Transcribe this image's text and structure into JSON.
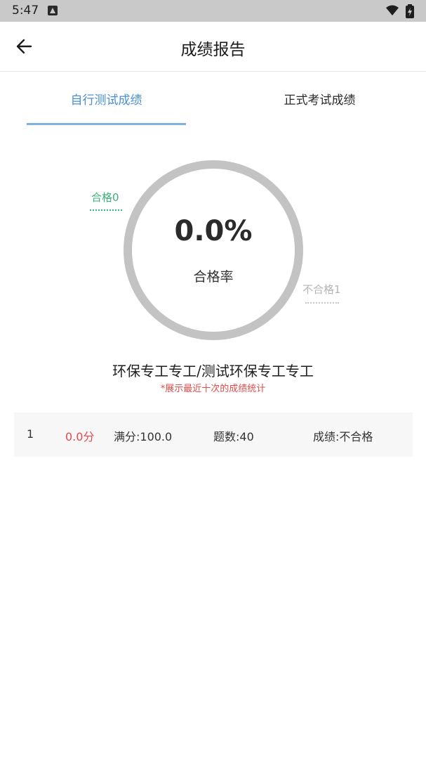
{
  "status_bar": {
    "time": "5:47",
    "icons": [
      "notification-icon",
      "wifi-icon",
      "battery-icon"
    ]
  },
  "app_bar": {
    "title": "成绩报告",
    "back_icon": "arrow-left-icon"
  },
  "tabs": [
    {
      "label": "自行测试成绩",
      "selected": true
    },
    {
      "label": "正式考试成绩",
      "selected": false
    }
  ],
  "gauge": {
    "pass_rate": "0.0%",
    "caption": "合格率",
    "pass_label": "合格0",
    "fail_label": "不合格1"
  },
  "subject": {
    "title": "环保专工专工/测试环保专工专工",
    "note": "*展示最近十次的成绩统计"
  },
  "records": [
    {
      "index": "1",
      "score": "0.0分",
      "full_score": "满分:100.0",
      "question_count": "题数:40",
      "result": "成绩:不合格"
    }
  ],
  "colors": {
    "accent": "#4a8fd6",
    "pass": "#3cb07a",
    "fail_text": "#e14b4b",
    "ring": "#c3c3c3"
  }
}
